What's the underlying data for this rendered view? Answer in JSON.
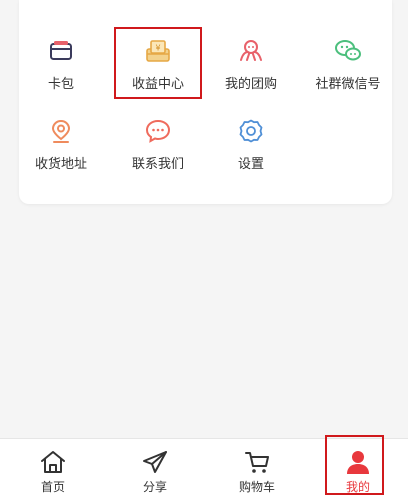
{
  "menu": {
    "items": [
      {
        "label": "卡包",
        "icon": "card-wallet-icon",
        "color": "#3b3b5c"
      },
      {
        "label": "收益中心",
        "icon": "earnings-icon",
        "color": "#e6a845"
      },
      {
        "label": "我的团购",
        "icon": "group-buy-icon",
        "color": "#e8616a"
      },
      {
        "label": "社群微信号",
        "icon": "wechat-icon",
        "color": "#4cbf7d"
      },
      {
        "label": "收货地址",
        "icon": "location-pin-icon",
        "color": "#ef8b5d"
      },
      {
        "label": "联系我们",
        "icon": "chat-bubble-icon",
        "color": "#ef6b5d"
      },
      {
        "label": "设置",
        "icon": "settings-gear-icon",
        "color": "#4f8fd6"
      }
    ]
  },
  "tabbar": {
    "items": [
      {
        "label": "首页",
        "icon": "home-icon"
      },
      {
        "label": "分享",
        "icon": "send-icon"
      },
      {
        "label": "购物车",
        "icon": "cart-icon"
      },
      {
        "label": "我的",
        "icon": "user-icon",
        "active": true
      }
    ]
  },
  "colors": {
    "accent": "#e8383d",
    "highlight_box": "#d0191c",
    "background": "#f5f5f5"
  }
}
